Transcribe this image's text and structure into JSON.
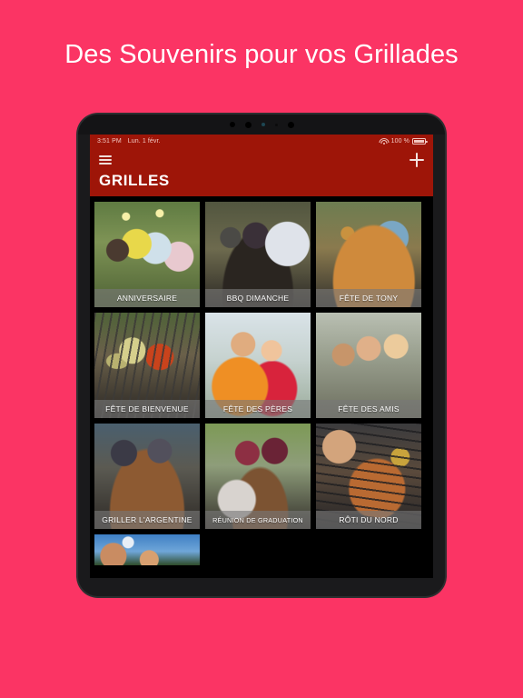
{
  "headline": "Des Souvenirs pour vos Grillades",
  "colors": {
    "background_pink": "#fb3464",
    "nav_red": "#9e1508",
    "device_frame": "#1a1a1c",
    "screen_black": "#000000"
  },
  "device": {
    "status_bar": {
      "time": "3:51 PM",
      "date": "Lun. 1 févr.",
      "wifi_icon": "wifi-icon",
      "battery_percent": "100 %",
      "battery_icon": "battery-full-icon"
    },
    "nav_bar": {
      "menu_icon": "hamburger-menu-icon",
      "title": "GRILLES",
      "add_icon": "plus-icon"
    },
    "grid": {
      "cards": [
        {
          "label": "ANNIVERSAIRE",
          "photo": "p-anniversaire",
          "small": false
        },
        {
          "label": "BBQ DIMANCHE",
          "photo": "p-bbq",
          "small": false
        },
        {
          "label": "FÊTE DE TONY",
          "photo": "p-tony",
          "small": false
        },
        {
          "label": "FÊTE DE BIENVENUE",
          "photo": "p-bienvenue",
          "small": false
        },
        {
          "label": "FÊTE DES PÈRES",
          "photo": "p-peres",
          "small": false
        },
        {
          "label": "FÊTE DES AMIS",
          "photo": "p-amis",
          "small": false
        },
        {
          "label": "GRILLER L'ARGENTINE",
          "photo": "p-argentine",
          "small": false
        },
        {
          "label": "RÉUNION DE GRADUATION",
          "photo": "p-graduation",
          "small": true
        },
        {
          "label": "RÔTI DU NORD",
          "photo": "p-roti",
          "small": false
        }
      ],
      "partial_card": {
        "label": "",
        "photo": "p-partial"
      }
    }
  }
}
